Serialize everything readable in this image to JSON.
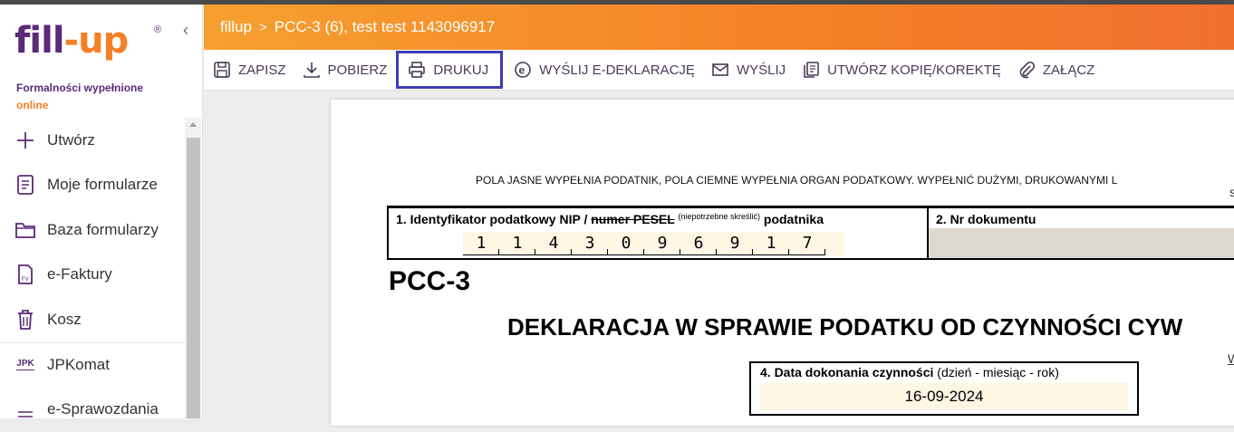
{
  "app": {
    "logo_main": "fill",
    "logo_dash": "-",
    "logo_up": "up",
    "logo_reg": "®",
    "tagline_1": "Formalności wypełnione",
    "tagline_2": "online"
  },
  "sidebar": {
    "items": [
      {
        "label": "Utwórz",
        "icon": "plus-icon"
      },
      {
        "label": "Moje formularze",
        "icon": "document-icon"
      },
      {
        "label": "Baza formularzy",
        "icon": "folder-icon"
      },
      {
        "label": "e-Faktury",
        "icon": "invoice-icon"
      },
      {
        "label": "Kosz",
        "icon": "trash-icon"
      },
      {
        "label": "JPKomat",
        "icon": "jpk-icon",
        "icon_text": "JPK"
      },
      {
        "label": "e-Sprawozdania",
        "icon": "report-icon"
      }
    ]
  },
  "header": {
    "crumb_root": "fillup",
    "crumb_sep": ">",
    "crumb_current": "PCC-3 (6), test test 1143096917"
  },
  "toolbar": {
    "save": "ZAPISZ",
    "download": "POBIERZ",
    "print": "DRUKUJ",
    "send_edecl": "WYŚLIJ E-DEKLARACJĘ",
    "send": "WYŚLIJ",
    "copy": "UTWÓRZ KOPIĘ/KOREKTĘ",
    "attach": "ZAŁĄCZ"
  },
  "document": {
    "note": "POLA JASNE WYPEŁNIA PODATNIK, POLA CIEMNE WYPEŁNIA ORGAN PODATKOWY. WYPEŁNIĆ DUŻYMI, DRUKOWANYMI L",
    "note_cont": "S",
    "field1_label_a": "1. Identyfikator podatkowy NIP / ",
    "field1_label_strike": "numer PESEL",
    "field1_label_small": "(niepotrzebne skreślić)",
    "field1_label_b": "podatnika",
    "nip_digits": [
      "1",
      "1",
      "4",
      "3",
      "0",
      "9",
      "6",
      "9",
      "1",
      "7"
    ],
    "field2_label": "2. Nr dokumentu",
    "form_code": "PCC-3",
    "title": "DEKLARACJA W SPRAWIE PODATKU OD CZYNNOŚCI CYW",
    "link_fragment": "W",
    "field4_label_bold": "4. Data dokonania czynności",
    "field4_label_rest": " (dzień - miesiąc - rok)",
    "field4_value": "16-09-2024"
  }
}
